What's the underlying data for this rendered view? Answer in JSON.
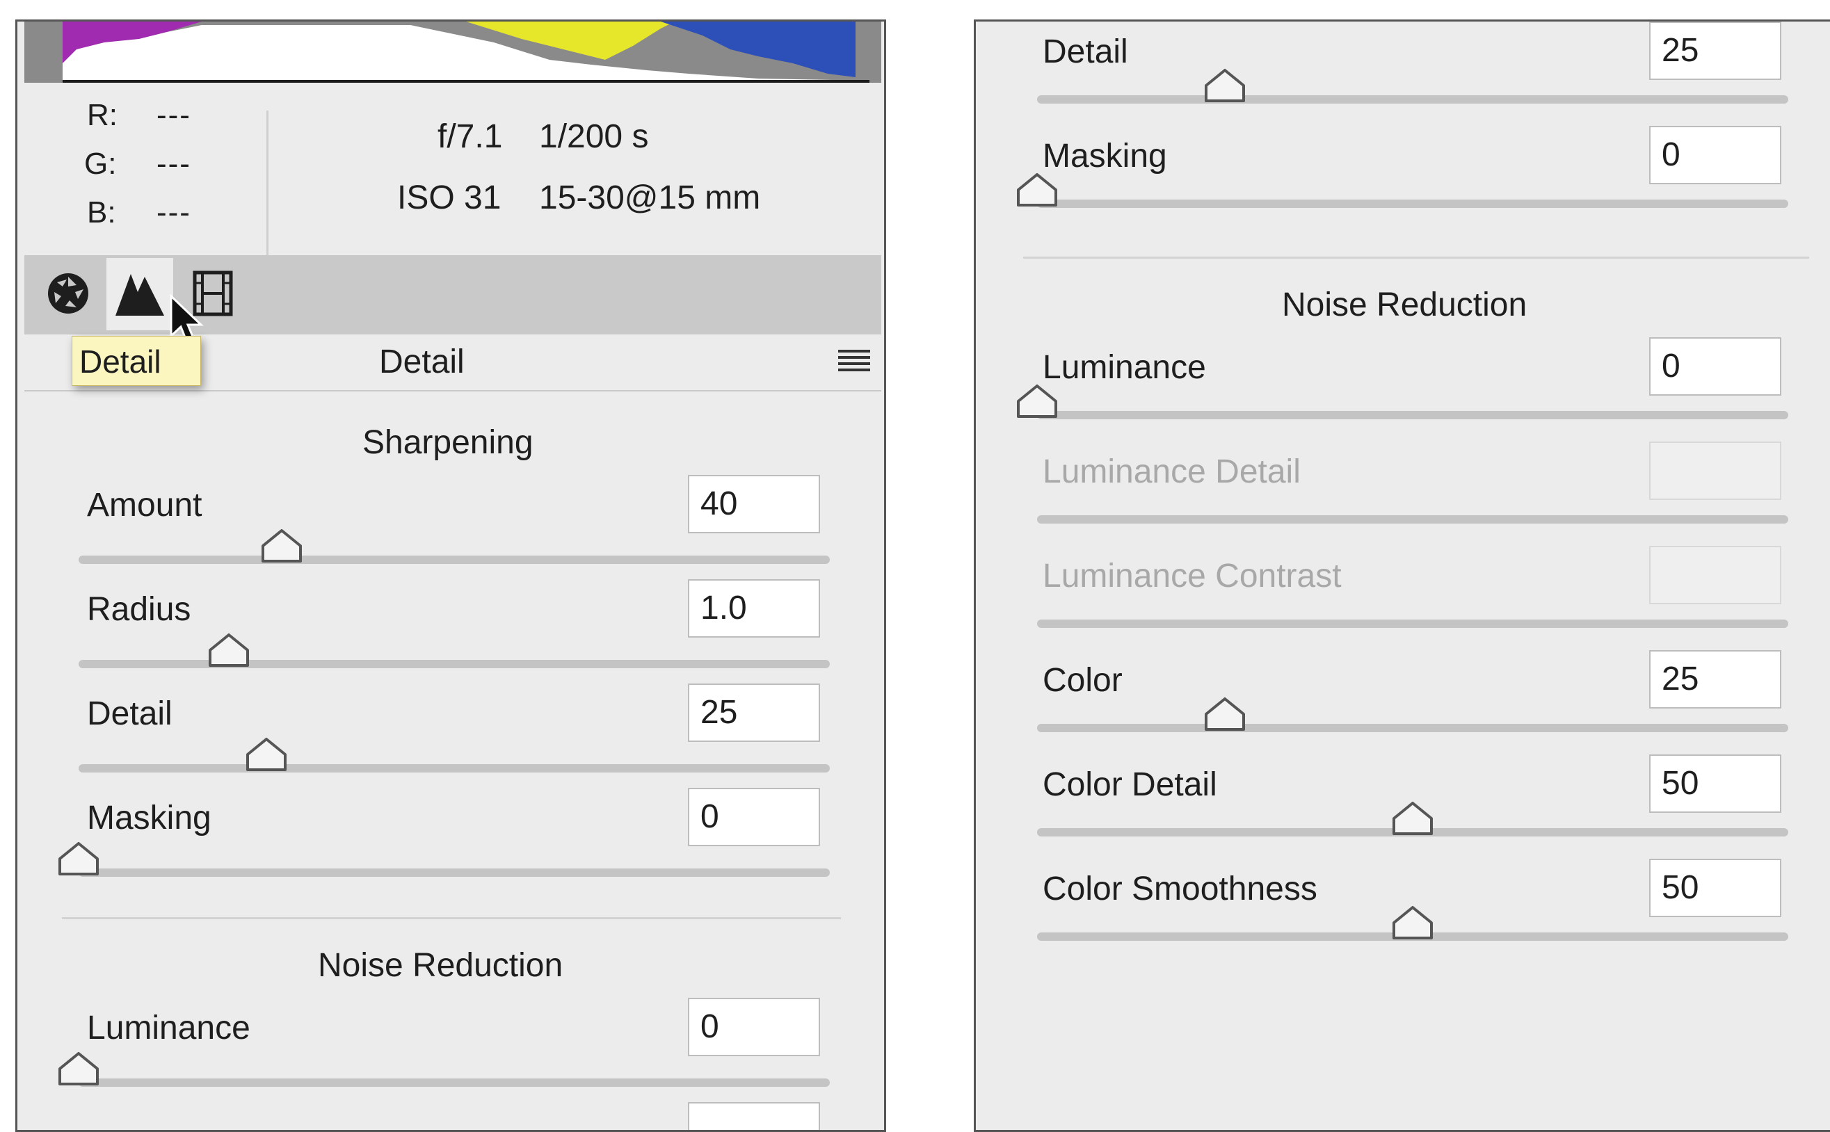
{
  "left_panel": {
    "rgb": [
      {
        "label": "R:",
        "value": "---"
      },
      {
        "label": "G:",
        "value": "---"
      },
      {
        "label": "B:",
        "value": "---"
      }
    ],
    "exif": {
      "aperture": "f/7.1",
      "shutter": "1/200 s",
      "iso": "ISO 31",
      "lens": "15-30@15 mm"
    },
    "tabs": [
      "aperture-icon",
      "detail-mountains-icon",
      "filmstrip-icon"
    ],
    "tooltip": "Detail",
    "panel_title": "Detail",
    "sharpening": {
      "title": "Sharpening",
      "rows": [
        {
          "label": "Amount",
          "value": "40",
          "slider": 0.27
        },
        {
          "label": "Radius",
          "value": "1.0",
          "slider": 0.2
        },
        {
          "label": "Detail",
          "value": "25",
          "slider": 0.25
        },
        {
          "label": "Masking",
          "value": "0",
          "slider": 0.0
        }
      ]
    },
    "noise": {
      "title": "Noise Reduction",
      "rows": [
        {
          "label": "Luminance",
          "value": "0",
          "slider": 0.0
        }
      ]
    }
  },
  "right_panel": {
    "top_rows": [
      {
        "label": "Detail",
        "value": "25",
        "slider": 0.25
      },
      {
        "label": "Masking",
        "value": "0",
        "slider": 0.0
      }
    ],
    "noise": {
      "title": "Noise Reduction",
      "rows": [
        {
          "label": "Luminance",
          "value": "0",
          "slider": 0.0,
          "disabled": false
        },
        {
          "label": "Luminance Detail",
          "value": "",
          "slider": null,
          "disabled": true
        },
        {
          "label": "Luminance Contrast",
          "value": "",
          "slider": null,
          "disabled": true
        },
        {
          "label": "Color",
          "value": "25",
          "slider": 0.25,
          "disabled": false
        },
        {
          "label": "Color Detail",
          "value": "50",
          "slider": 0.5,
          "disabled": false
        },
        {
          "label": "Color Smoothness",
          "value": "50",
          "slider": 0.5,
          "disabled": false
        }
      ]
    }
  },
  "colors": {
    "panel_bg": "#ececec",
    "toolbar_bg": "#c9c9c9",
    "tooltip_bg": "#fbf5c0",
    "track": "#c4c4c4"
  }
}
